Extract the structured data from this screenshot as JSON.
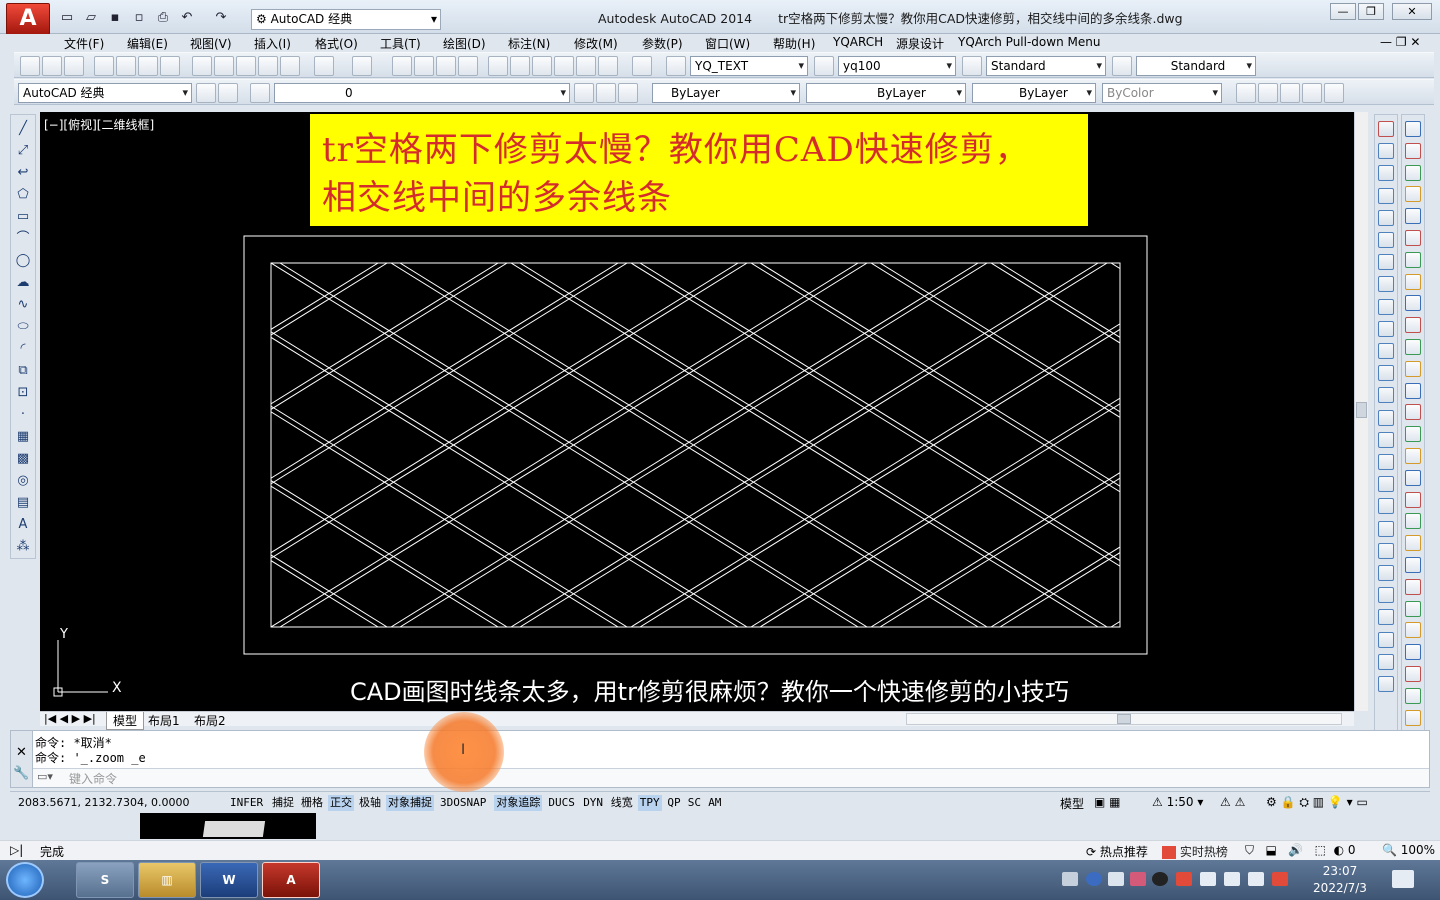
{
  "window": {
    "app_name": "Autodesk AutoCAD 2014",
    "doc_title": "tr空格两下修剪太慢？教你用CAD快速修剪，相交线中间的多余线条.dwg",
    "workspace": "AutoCAD 经典",
    "controls": [
      "—",
      "❐",
      "✕"
    ]
  },
  "menu": [
    "文件(F)",
    "编辑(E)",
    "视图(V)",
    "插入(I)",
    "格式(O)",
    "工具(T)",
    "绘图(D)",
    "标注(N)",
    "修改(M)",
    "参数(P)",
    "窗口(W)",
    "帮助(H)",
    "YQARCH",
    "源泉设计",
    "YQArch Pull-down Menu"
  ],
  "toolbar1": {
    "text_style": "YQ_TEXT",
    "dim_style": "yq100",
    "table_style": "Standard",
    "multileader_style": "Standard"
  },
  "toolbar2": {
    "workspace": "AutoCAD 经典",
    "layer": "0",
    "color": "ByLayer",
    "linetype": "ByLayer",
    "lineweight": "ByLayer",
    "plotstyle": "ByColor"
  },
  "viewport": {
    "label": "[−][俯视][二维线框]",
    "banner_line1": "tr空格两下修剪太慢？教你用CAD快速修剪，",
    "banner_line2": "相交线中间的多余线条",
    "subtitle": "CAD画图时线条太多，用tr修剪很麻烦？教你一个快速修剪的小技巧",
    "ucs_x": "X",
    "ucs_y": "Y"
  },
  "layout_tabs": [
    "模型",
    "布局1",
    "布局2"
  ],
  "command": {
    "history": [
      "命令: *取消*",
      "命令: '_.zoom _e"
    ],
    "placeholder": "键入命令"
  },
  "status": {
    "coordinates": "2083.5671, 2132.7304, 0.0000",
    "toggles": [
      {
        "label": "INFER",
        "on": false
      },
      {
        "label": "捕捉",
        "on": false
      },
      {
        "label": "栅格",
        "on": false
      },
      {
        "label": "正交",
        "on": true
      },
      {
        "label": "极轴",
        "on": false
      },
      {
        "label": "对象捕捉",
        "on": true
      },
      {
        "label": "3DOSNAP",
        "on": false
      },
      {
        "label": "对象追踪",
        "on": true
      },
      {
        "label": "DUCS",
        "on": false
      },
      {
        "label": "DYN",
        "on": false
      },
      {
        "label": "线宽",
        "on": false
      },
      {
        "label": "TPY",
        "on": true
      },
      {
        "label": "QP",
        "on": false
      },
      {
        "label": "SC",
        "on": false
      },
      {
        "label": "AM",
        "on": false
      }
    ],
    "model_label": "模型",
    "scale": "1:50"
  },
  "bottom_status": {
    "state": "完成",
    "hot_recommend": "热点推荐",
    "realtime_hot": "实时热榜",
    "zoom": "100%",
    "count": "0"
  },
  "taskbar": {
    "time": "23:07",
    "date": "2022/7/3"
  },
  "colors": {
    "banner_bg": "#ffff00",
    "banner_text": "#d42c2c",
    "drawing_bg": "#000000",
    "drawing_lines": "#ffffff"
  }
}
